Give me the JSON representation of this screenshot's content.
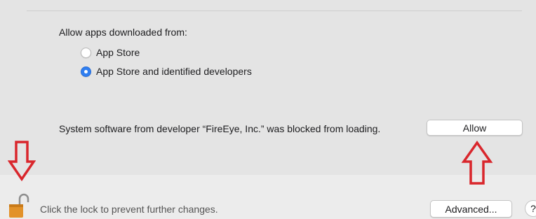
{
  "security": {
    "allow_label": "Allow apps downloaded from:",
    "options": [
      {
        "label": "App Store",
        "selected": false
      },
      {
        "label": "App Store and identified developers",
        "selected": true
      }
    ],
    "blocked_message": "System software from developer “FireEye, Inc.” was blocked from loading.",
    "allow_button": "Allow"
  },
  "footer": {
    "lock_message": "Click the lock to prevent further changes.",
    "advanced_button": "Advanced...",
    "help_button": "?"
  },
  "colors": {
    "accent": "#2f7ef0",
    "annotation": "#d9262c",
    "lock": "#e2922a"
  },
  "icons": [
    "radio-unchecked-icon",
    "radio-checked-icon",
    "lock-open-icon",
    "down-arrow-annotation",
    "up-arrow-annotation"
  ]
}
